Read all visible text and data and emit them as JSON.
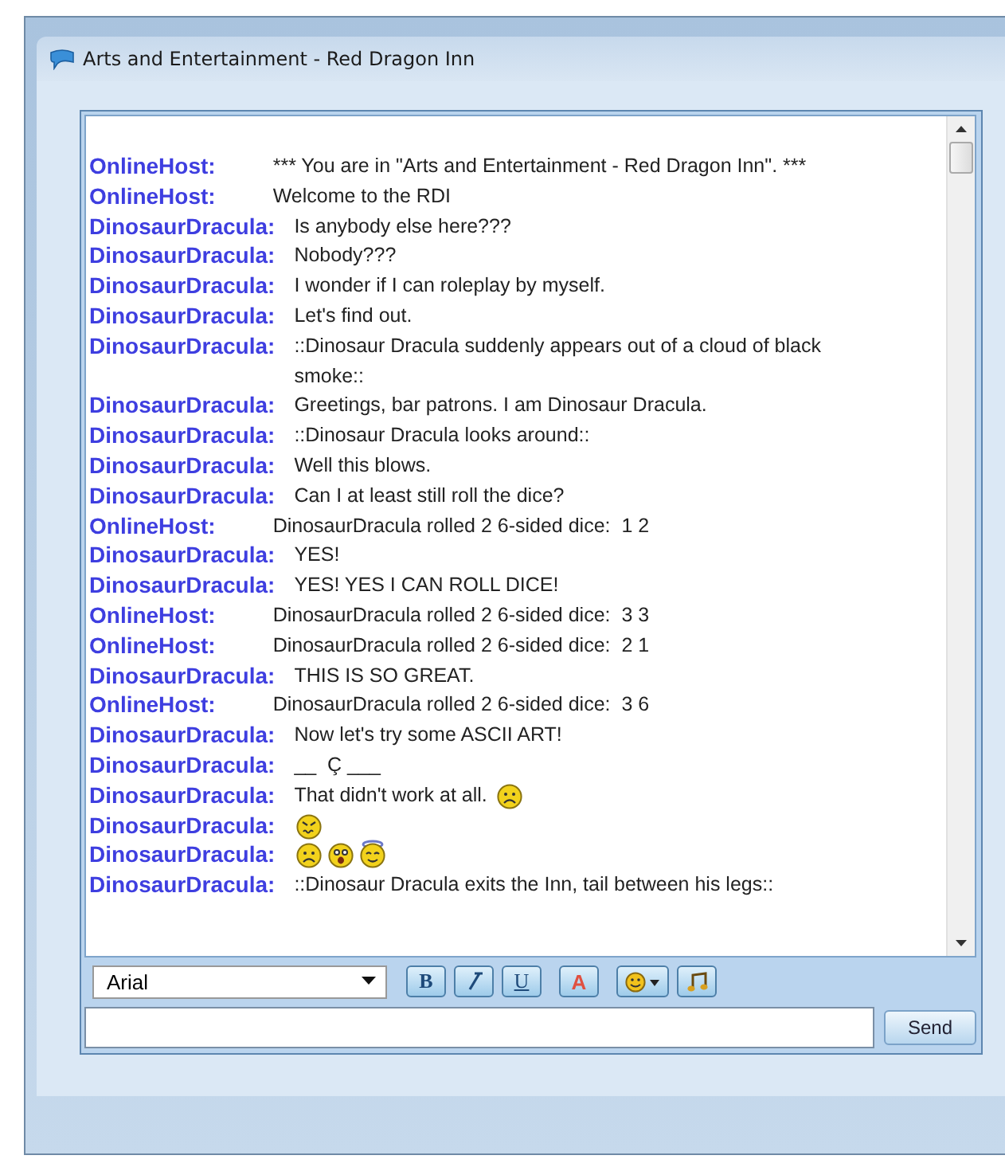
{
  "window": {
    "title": "Arts and Entertainment - Red Dragon Inn"
  },
  "messages": [
    {
      "sender": "OnlineHost:",
      "kind": "host",
      "text": "*** You are in \"Arts and Entertainment - Red Dragon Inn\". ***"
    },
    {
      "sender": "OnlineHost:",
      "kind": "host",
      "text": "Welcome to the RDI"
    },
    {
      "sender": "DinosaurDracula:",
      "kind": "user",
      "text": "Is anybody else here???"
    },
    {
      "sender": "DinosaurDracula:",
      "kind": "user",
      "text": "Nobody???"
    },
    {
      "sender": "DinosaurDracula:",
      "kind": "user",
      "text": "I wonder if I can roleplay by myself."
    },
    {
      "sender": "DinosaurDracula:",
      "kind": "user",
      "text": "Let's find out."
    },
    {
      "sender": "DinosaurDracula:",
      "kind": "user",
      "text": "::Dinosaur Dracula suddenly appears out of a cloud of black smoke::"
    },
    {
      "sender": "DinosaurDracula:",
      "kind": "user",
      "text": "Greetings, bar patrons. I am Dinosaur Dracula."
    },
    {
      "sender": "DinosaurDracula:",
      "kind": "user",
      "text": "::Dinosaur Dracula looks around::"
    },
    {
      "sender": "DinosaurDracula:",
      "kind": "user",
      "text": "Well this blows."
    },
    {
      "sender": "DinosaurDracula:",
      "kind": "user",
      "text": "Can I at least still roll the dice?"
    },
    {
      "sender": "OnlineHost:",
      "kind": "host",
      "text": "DinosaurDracula rolled 2 6-sided dice:  1 2"
    },
    {
      "sender": "DinosaurDracula:",
      "kind": "user",
      "text": "YES!"
    },
    {
      "sender": "DinosaurDracula:",
      "kind": "user",
      "text": "YES! YES I CAN ROLL DICE!"
    },
    {
      "sender": "OnlineHost:",
      "kind": "host",
      "text": "DinosaurDracula rolled 2 6-sided dice:  3 3"
    },
    {
      "sender": "OnlineHost:",
      "kind": "host",
      "text": "DinosaurDracula rolled 2 6-sided dice:  2 1"
    },
    {
      "sender": "DinosaurDracula:",
      "kind": "user",
      "text": "THIS IS SO GREAT."
    },
    {
      "sender": "OnlineHost:",
      "kind": "host",
      "text": "DinosaurDracula rolled 2 6-sided dice:  3 6"
    },
    {
      "sender": "DinosaurDracula:",
      "kind": "user",
      "text": "Now let's try some ASCII ART!"
    },
    {
      "sender": "DinosaurDracula:",
      "kind": "user",
      "text": "__  Ç ___"
    },
    {
      "sender": "DinosaurDracula:",
      "kind": "user",
      "text": "That didn't work at all.",
      "emoticons": [
        {
          "kind": "sad"
        }
      ]
    },
    {
      "sender": "DinosaurDracula:",
      "kind": "user",
      "emoticons": [
        {
          "kind": "sick"
        }
      ]
    },
    {
      "sender": "DinosaurDracula:",
      "kind": "user",
      "emoticons": [
        {
          "kind": "sad"
        },
        {
          "kind": "shocked"
        },
        {
          "kind": "angel"
        }
      ]
    },
    {
      "sender": "DinosaurDracula:",
      "kind": "user",
      "text": "::Dinosaur Dracula exits the Inn, tail between his legs::"
    }
  ],
  "toolbar": {
    "font": "Arial",
    "buttons": [
      {
        "kind": "bold",
        "label": "B"
      },
      {
        "kind": "italic"
      },
      {
        "kind": "underline",
        "label": "U"
      },
      {
        "kind": "color",
        "label": "A"
      },
      {
        "kind": "smiley"
      },
      {
        "kind": "sound"
      }
    ]
  },
  "send_button": "Send"
}
